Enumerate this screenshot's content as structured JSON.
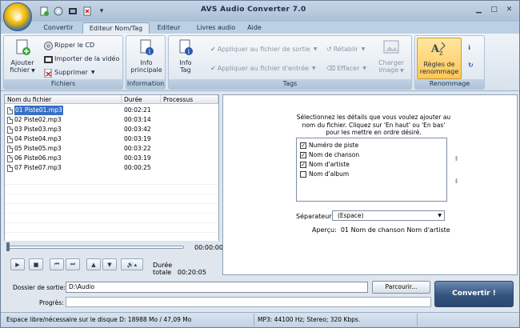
{
  "window": {
    "title": "AVS Audio Converter  7.0"
  },
  "quick_access": [
    "new-file-icon",
    "disc-icon",
    "video-icon",
    "delete-icon",
    "dropdown-icon"
  ],
  "tabs": [
    {
      "label": "Convertir"
    },
    {
      "label": "Editeur Nom/Tag"
    },
    {
      "label": "Editeur"
    },
    {
      "label": "Livres audio"
    },
    {
      "label": "Aide"
    }
  ],
  "ribbon": {
    "fichiers": {
      "label": "Fichiers",
      "add_label1": "Ajouter",
      "add_label2": "fichier",
      "rip": "Ripper le CD",
      "import": "Importer de la vidéo",
      "delete": "Supprimer"
    },
    "information": {
      "label": "Information",
      "info1": "Info",
      "info2": "principale"
    },
    "tags": {
      "label": "Tags",
      "info1": "Info",
      "info2": "Tag",
      "apply_out": "Appliquer au fichier de sortie",
      "apply_in": "Appliquer au fichier d'entrée",
      "restore": "Rétablir",
      "clear": "Effacer",
      "load1": "Charger",
      "load2": "image"
    },
    "rename": {
      "label": "Renommage",
      "rules1": "Règles de",
      "rules2": "renommage"
    }
  },
  "filelist": {
    "headers": [
      "Nom du fichier",
      "Durée",
      "Processus"
    ],
    "rows": [
      {
        "name": "01 Piste01.mp3",
        "duration": "00:02:21"
      },
      {
        "name": "02 Piste02.mp3",
        "duration": "00:03:14"
      },
      {
        "name": "03 Piste03.mp3",
        "duration": "00:03:42"
      },
      {
        "name": "04 Piste04.mp3",
        "duration": "00:03:19"
      },
      {
        "name": "05 Piste05.mp3",
        "duration": "00:03:22"
      },
      {
        "name": "06 Piste06.mp3",
        "duration": "00:03:19"
      },
      {
        "name": "07 Piste07.mp3",
        "duration": "00:00:25"
      }
    ]
  },
  "player": {
    "time": "00:00:00",
    "total_label": "Durée totale",
    "total": "00:20:05"
  },
  "rename_panel": {
    "instructions": "Sélectionnez les détails que vous voulez ajouter au nom du fichier. Cliquez sur 'En haut' ou 'En bas' pour les mettre en ordre désiré.",
    "fields": [
      {
        "label": "Numéro de piste",
        "checked": true
      },
      {
        "label": "Nom de chanson",
        "checked": true
      },
      {
        "label": "Nom d'artiste",
        "checked": true
      },
      {
        "label": "Nom d'album",
        "checked": false
      }
    ],
    "separator_label": "Séparateur:",
    "separator_value": "(Espace)",
    "preview_label": "Aperçu:",
    "preview_value": "01 Nom de chanson Nom d'artiste"
  },
  "bottom": {
    "output_label": "Dossier de sortie:",
    "output_value": "D:\\Audio",
    "browse": "Parcourir...",
    "progress_label": "Progrès:",
    "convert": "Convertir !"
  },
  "status": {
    "disk": "Espace libre/nécessaire sur le disque D: 18988 Mo / 47,09 Mo",
    "format": "MP3: 44100  Hz; Stereo; 320 Kbps."
  }
}
